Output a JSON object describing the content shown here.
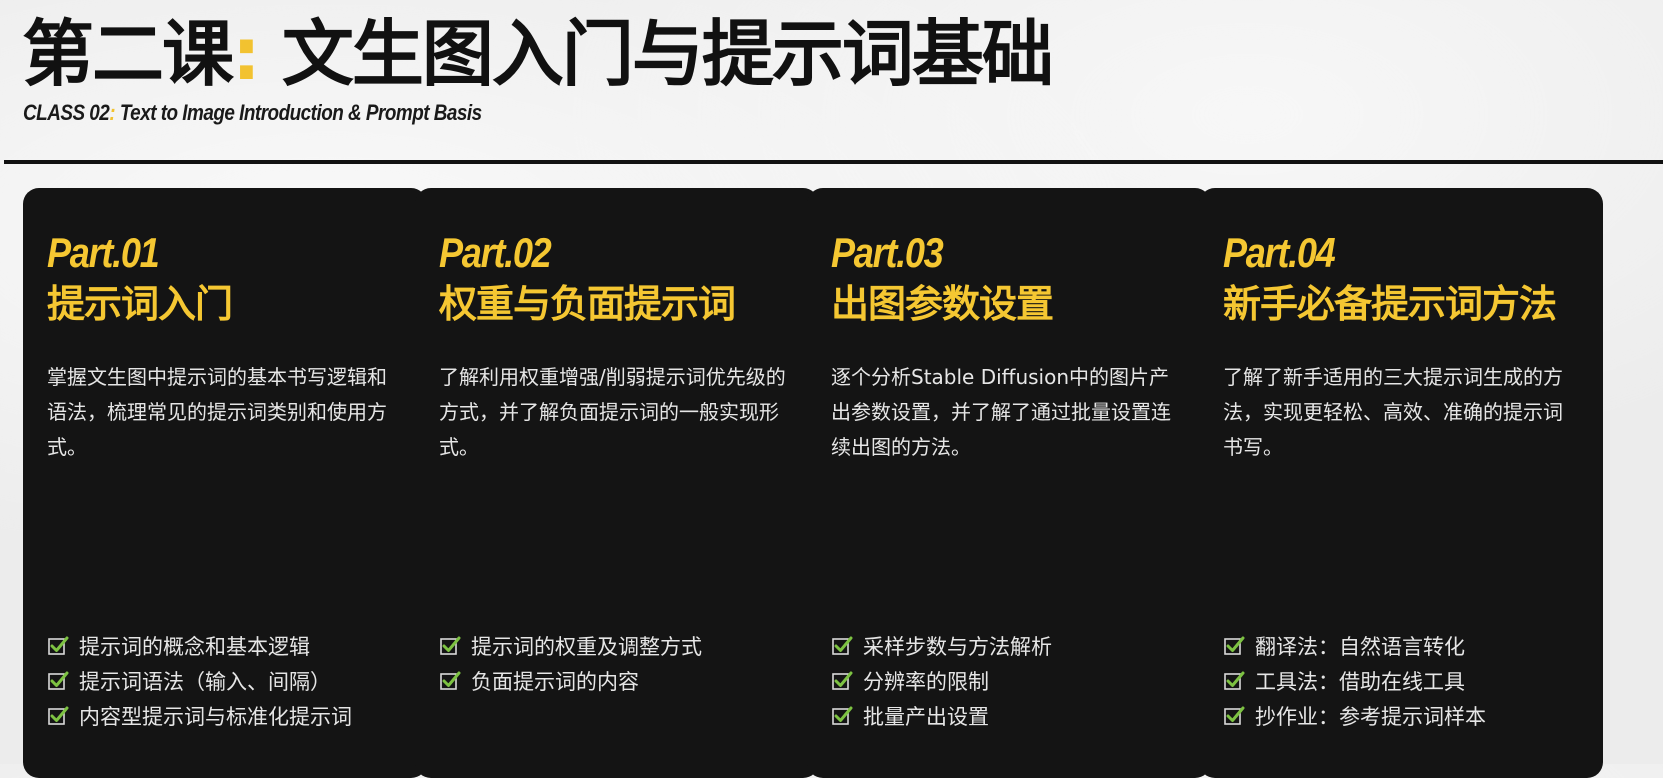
{
  "header": {
    "title_prefix": "第二课",
    "title_colon": ":",
    "title_main": "文生图入门与提示词基础",
    "subtitle_prefix": "CLASS 02",
    "subtitle_colon": ":",
    "subtitle_main": "Text to Image Introduction & Prompt Basis"
  },
  "colors": {
    "accent": "#f5c732",
    "card_background": "#141414",
    "check_box": "#d9d9d9",
    "check_mark": "#7dc242"
  },
  "icons": {
    "list_item": "checkbox-checked-icon"
  },
  "cards": [
    {
      "part": "Part.01",
      "title": "提示词入门",
      "description": "掌握文生图中提示词的基本书写逻辑和语法，梳理常见的提示词类别和使用方式。",
      "items": [
        "提示词的概念和基本逻辑",
        "提示词语法（输入、间隔）",
        "内容型提示词与标准化提示词"
      ]
    },
    {
      "part": "Part.02",
      "title": "权重与负面提示词",
      "description": "了解利用权重增强/削弱提示词优先级的方式，并了解负面提示词的一般实现形式。",
      "items": [
        "提示词的权重及调整方式",
        "负面提示词的内容"
      ]
    },
    {
      "part": "Part.03",
      "title": "出图参数设置",
      "description": "逐个分析Stable Diffusion中的图片产出参数设置，并了解了通过批量设置连续出图的方法。",
      "items": [
        "采样步数与方法解析",
        "分辨率的限制",
        "批量产出设置"
      ]
    },
    {
      "part": "Part.04",
      "title": "新手必备提示词方法",
      "description": "了解了新手适用的三大提示词生成的方法，实现更轻松、高效、准确的提示词书写。",
      "items": [
        "翻译法：自然语言转化",
        "工具法：借助在线工具",
        "抄作业：参考提示词样本"
      ]
    }
  ]
}
